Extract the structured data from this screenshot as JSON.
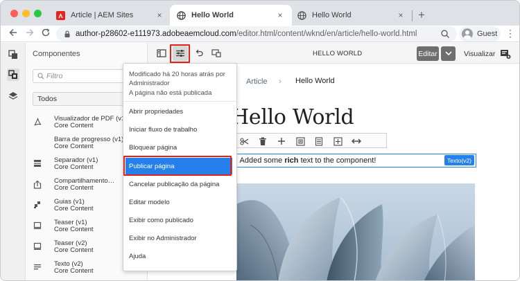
{
  "browser": {
    "tabs": [
      {
        "title": "Article | AEM Sites",
        "favicon": "adobe-icon",
        "active": false
      },
      {
        "title": "Hello World",
        "favicon": "globe-icon",
        "active": true
      },
      {
        "title": "Hello World",
        "favicon": "globe-icon",
        "active": false
      }
    ],
    "new_tab": "+",
    "close_glyph": "×",
    "url_host": "author-p28602-e111973.adobeaemcloud.com",
    "url_path": "/editor.html/content/wknd/en/article/hello-world.html",
    "profile_label": "Guest"
  },
  "rail": {
    "icons": [
      "assets-icon",
      "components-icon",
      "layers-icon"
    ],
    "selected": "components-icon"
  },
  "panel": {
    "title": "Componentes",
    "filter_placeholder": "Filtro",
    "group_select": "Todos",
    "components": [
      {
        "name": "Visualizador de PDF (v1)",
        "group": "Core Content",
        "icon": "pdf-icon"
      },
      {
        "name": "Barra de progresso (v1)",
        "group": "Core Content",
        "icon": "progress-icon"
      },
      {
        "name": "Separador (v1)",
        "group": "Core Content",
        "icon": "separator-icon"
      },
      {
        "name": "Compartilhamento…",
        "group": "Core Content",
        "icon": "share-icon"
      },
      {
        "name": "Guias (v1)",
        "group": "Core Content",
        "icon": "tabs-icon"
      },
      {
        "name": "Teaser (v1)",
        "group": "Core Content",
        "icon": "teaser-icon"
      },
      {
        "name": "Teaser (v2)",
        "group": "Core Content",
        "icon": "teaser-icon"
      },
      {
        "name": "Texto (v2)",
        "group": "Core Content",
        "icon": "text-icon"
      }
    ]
  },
  "editor": {
    "page_name": "HELLO WORLD",
    "edit_label": "Editar",
    "view_label": "Visualizar"
  },
  "page": {
    "breadcrumb": {
      "parent": "Article",
      "separator": "›",
      "current": "Hello World"
    },
    "heading": "Hello World",
    "text_before": "! Added some ",
    "text_bold": "rich",
    "text_after": " text to the component!",
    "component_badge": "Texto(v2)"
  },
  "page_info": {
    "modified_line1": "Modificado há 20 horas atrás por",
    "modified_line2": "Administrador",
    "status": "A página não está publicada",
    "menu": [
      "Abrir propriedades",
      "Iniciar fluxo de trabalho",
      "Bloquear página",
      "Publicar página",
      "Cancelar publicação da página",
      "Editar modelo",
      "Exibir como publicado",
      "Exibir no Administrador",
      "Ajuda"
    ],
    "highlighted": "Publicar página"
  },
  "colors": {
    "accent": "#2680eb",
    "highlight_box": "#e2231a",
    "tab_strip": "#dee1e6"
  }
}
